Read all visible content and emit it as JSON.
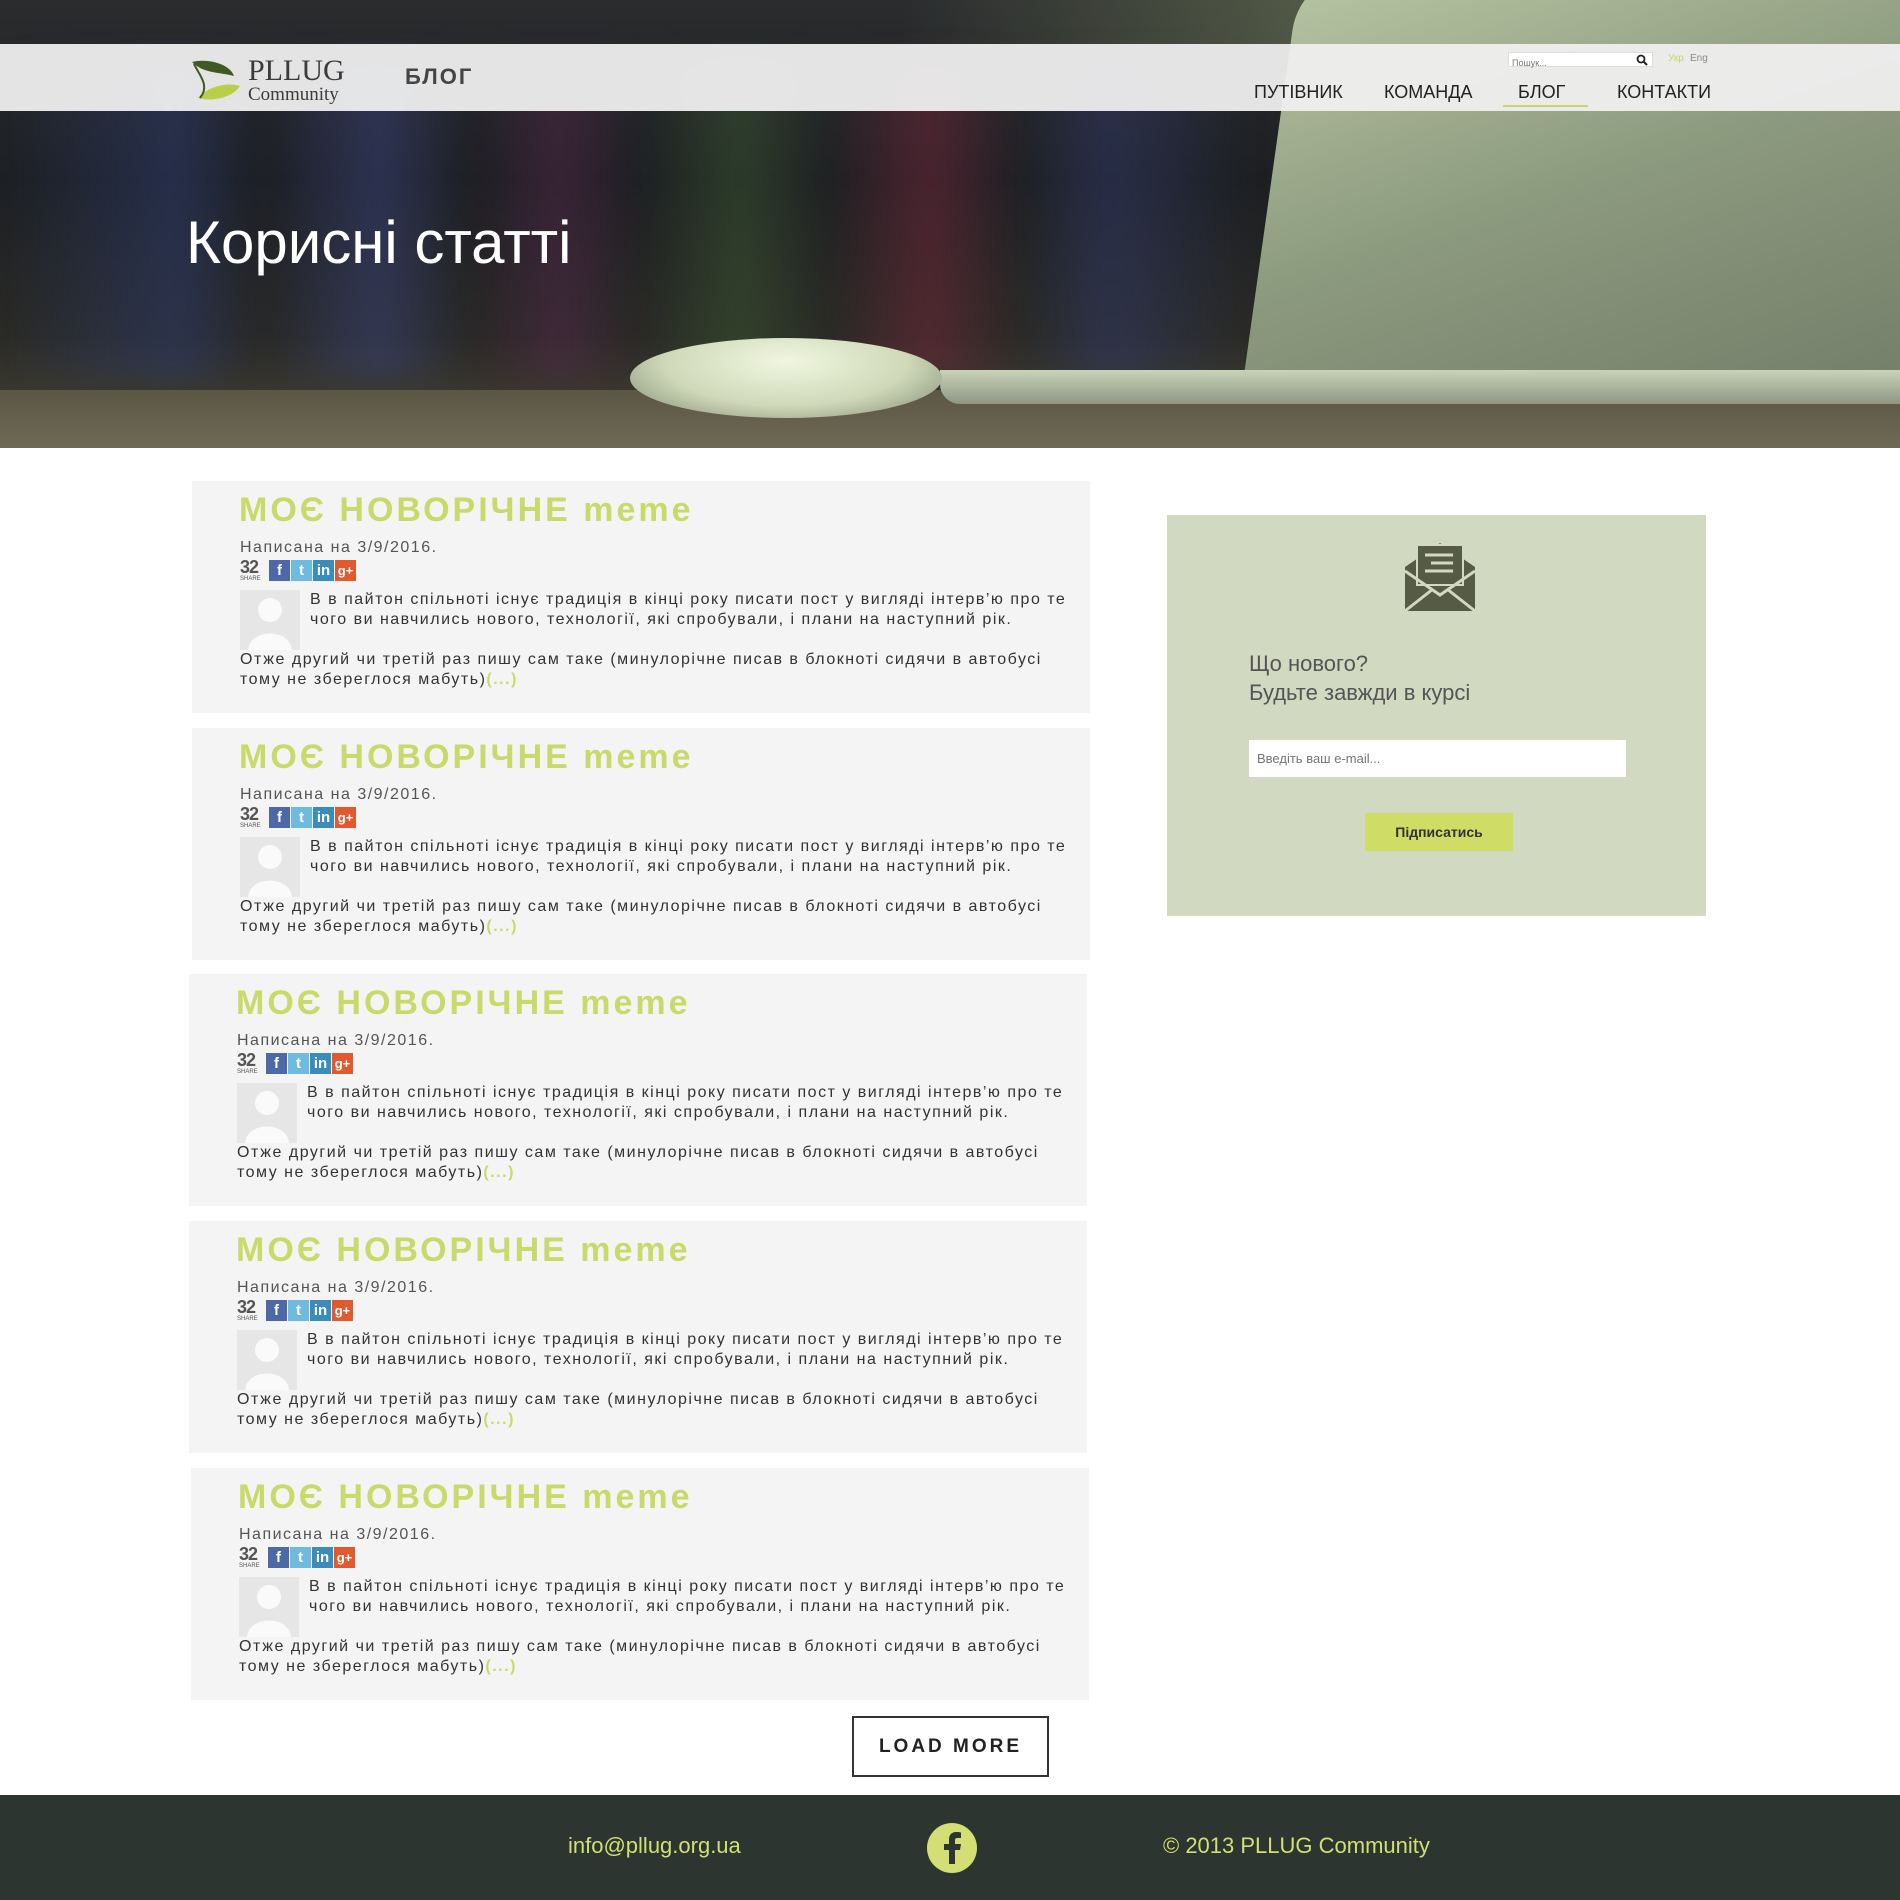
{
  "header": {
    "logo_title": "PLLUG",
    "logo_subtitle": "Community",
    "section": "БЛОГ",
    "search_placeholder": "Пошук...",
    "lang_ua": "Укр",
    "lang_en": "Eng",
    "nav": [
      "ПУТІВНИК",
      "КОМАНДА",
      "БЛОГ",
      "КОНТАКТИ"
    ],
    "active_nav": "БЛОГ"
  },
  "hero": {
    "title": "Корисні статті"
  },
  "posts": [
    {
      "title": "МОЄ НОВОРІЧНЕ meme",
      "meta": "Написана на 3/9/2016.",
      "share_count": "32",
      "share_label": "SHARE",
      "excerpt_1": "В в пайтон спільноті існує традиція в кінці року писати пост у вигляді інтерв’ю про те чого ви навчились нового, технології, які спробували, і плани на наступний рік.",
      "excerpt_2": "Отже другий чи третій раз пишу сам таке (минулорічне писав в блокноті сидячи в автобусі тому не збереглося мабуть)",
      "more": "(...)"
    },
    {
      "title": "МОЄ НОВОРІЧНЕ meme",
      "meta": "Написана на 3/9/2016.",
      "share_count": "32",
      "share_label": "SHARE",
      "excerpt_1": "В в пайтон спільноті існує традиція в кінці року писати пост у вигляді інтерв’ю про те чого ви навчились нового, технології, які спробували, і плани на наступний рік.",
      "excerpt_2": "Отже другий чи третій раз пишу сам таке (минулорічне писав в блокноті сидячи в автобусі тому не збереглося мабуть)",
      "more": "(...)"
    },
    {
      "title": "МОЄ НОВОРІЧНЕ meme",
      "meta": "Написана на 3/9/2016.",
      "share_count": "32",
      "share_label": "SHARE",
      "excerpt_1": "В в пайтон спільноті існує традиція в кінці року писати пост у вигляді інтерв’ю про те чого ви навчились нового, технології, які спробували, і плани на наступний рік.",
      "excerpt_2": "Отже другий чи третій раз пишу сам таке (минулорічне писав в блокноті сидячи в автобусі тому не збереглося мабуть)",
      "more": "(...)"
    },
    {
      "title": "МОЄ НОВОРІЧНЕ meme",
      "meta": "Написана на 3/9/2016.",
      "share_count": "32",
      "share_label": "SHARE",
      "excerpt_1": "В в пайтон спільноті існує традиція в кінці року писати пост у вигляді інтерв’ю про те чого ви навчились нового, технології, які спробували, і плани на наступний рік.",
      "excerpt_2": "Отже другий чи третій раз пишу сам таке (минулорічне писав в блокноті сидячи в автобусі тому не збереглося мабуть)",
      "more": "(...)"
    },
    {
      "title": "МОЄ НОВОРІЧНЕ meme",
      "meta": "Написана на 3/9/2016.",
      "share_count": "32",
      "share_label": "SHARE",
      "excerpt_1": "В в пайтон спільноті існує традиція в кінці року писати пост у вигляді інтерв’ю про те чого ви навчились нового, технології, які спробували, і плани на наступний рік.",
      "excerpt_2": "Отже другий чи третій раз пишу сам таке (минулорічне писав в блокноті сидячи в автобусі тому не збереглося мабуть)",
      "more": "(...)"
    }
  ],
  "load_more": "LOAD MORE",
  "subscribe": {
    "heading_1": "Що нового?",
    "heading_2": "Будьте завжди в курсі",
    "email_placeholder": "Введіть ваш e-mail...",
    "button": "Підписатись"
  },
  "footer": {
    "email": "info@pllug.org.ua",
    "copyright": "© 2013 PLLUG Community"
  },
  "colors": {
    "accent": "#c9d96a",
    "sidebar_bg": "#d1d9c1",
    "footer_bg": "#2c3530",
    "post_bg": "#f4f4f4"
  },
  "icons": {
    "search": "search-icon",
    "envelope": "envelope-icon",
    "facebook": "facebook-icon"
  }
}
